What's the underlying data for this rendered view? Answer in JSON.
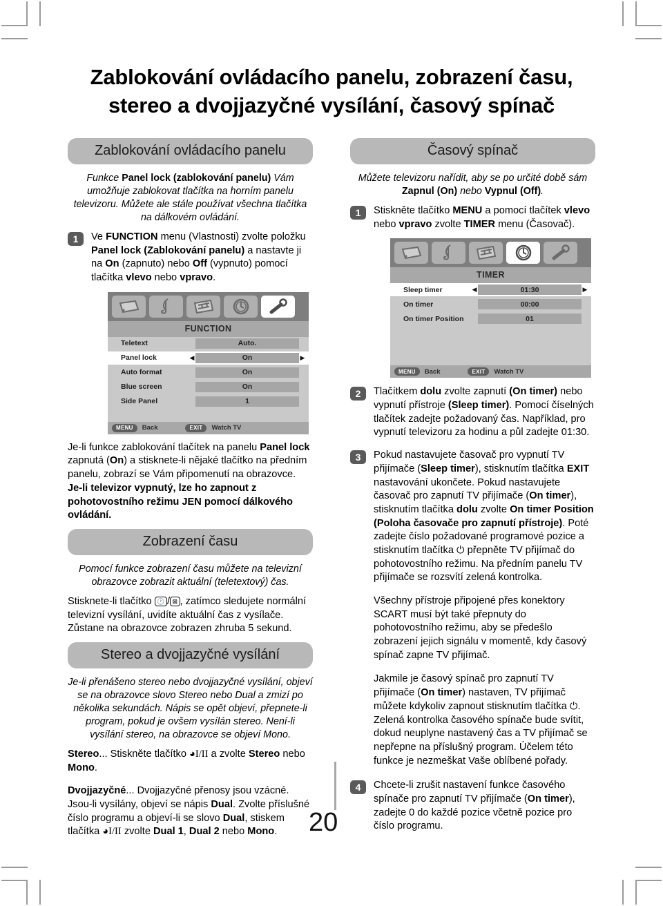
{
  "page": {
    "number": "20",
    "title_line1": "Zablokování ovládacího panelu, zobrazení času,",
    "title_line2": "stereo a dvojjazyčné vysílání, časový spínač"
  },
  "left_column": {
    "section1": {
      "banner": "Zablokování ovládacího panelu",
      "intro": "Funkce Panel lock (zablokování panelu) Vám umožňuje zablokovat tlačítka na horním panelu televizoru. Můžete ale stále používat všechna tlačítka na dálkovém ovládání.",
      "step1_number": "1",
      "step1_text": "Ve FUNCTION menu (Vlastnosti) zvolte položku Panel lock (Zablokování panelu) a nastavte ji na On (zapnuto) nebo Off (vypnuto) pomocí tlačítka vlevo nebo vpravo.",
      "after_text": "Je-li funkce zablokování tlačítek na panelu Panel lock zapnutá (On) a stisknete-li nějaké tlačítko na předním panelu, zobrazí se Vám připomenutí na obrazovce. Je-li televizor vypnutý, lze ho zapnout z pohotovostního režimu JEN pomocí dálkového ovládání."
    },
    "function_menu": {
      "title": "FUNCTION",
      "icons": [
        "picture-icon",
        "sound-icon",
        "feature-icon",
        "timer-icon",
        "setup-icon"
      ],
      "selected_icon_index": 4,
      "rows": [
        {
          "label": "Teletext",
          "value": "Auto.",
          "active": false
        },
        {
          "label": "Panel lock",
          "value": "On",
          "active": true
        },
        {
          "label": "Auto format",
          "value": "On",
          "active": false
        },
        {
          "label": "Blue screen",
          "value": "On",
          "active": false
        },
        {
          "label": "Side Panel",
          "value": "1",
          "active": false
        }
      ],
      "footer_menu_key": "MENU",
      "footer_menu_label": "Back",
      "footer_exit_key": "EXIT",
      "footer_exit_label": "Watch TV"
    },
    "section2": {
      "banner": "Zobrazení času",
      "intro": "Pomocí funkce zobrazení času můžete na televizní obrazovce zobrazit aktuální (teletextový) čas.",
      "body_a": "Stisknete-li tlačítko",
      "body_b": ", zatímco sledujete normální televizní vysílání, uvidíte aktuální čas z vysílače. Zůstane na obrazovce zobrazen zhruba 5 sekund."
    },
    "section3": {
      "banner": "Stereo a dvojjazyčné vysílání",
      "intro": "Je-li přenášeno stereo nebo dvojjazyčné vysílání, objeví se  na obrazovce slovo Stereo nebo Dual a zmizí po několika sekundách. Nápis se opět objeví, přepnete-li program, pokud je ovšem vysílán stereo. Není-li vysílání stereo, na obrazovce se objeví Mono.",
      "stereo_label": "Stereo",
      "stereo_a": "... Stiskněte tlačítko",
      "stereo_b": "a zvolte Stereo nebo Mono.",
      "dual_label": "Dvojjazyčné",
      "dual_a": "... Dvojjazyčné přenosy jsou vzácné. Jsou-li vysílány, objeví se nápis Dual. Zvolte příslušné číslo programu a objeví-li se slovo Dual, stiskem tlačítka",
      "dual_b": "zvolte Dual 1, Dual 2 nebo Mono."
    }
  },
  "right_column": {
    "banner": "Časový spínač",
    "intro_a": "Můžete televizoru nařídit, aby se po určité době sám ",
    "intro_b": "Zapnul (On)",
    "intro_c": " nebo ",
    "intro_d": "Vypnul (Off)",
    "intro_e": ".",
    "step1_number": "1",
    "step1_text": "Stiskněte tlačítko MENU a pomocí tlačítek vlevo nebo vpravo zvolte TIMER menu (Časovač).",
    "timer_menu": {
      "title": "TIMER",
      "icons": [
        "picture-icon",
        "sound-icon",
        "feature-icon",
        "timer-icon",
        "setup-icon"
      ],
      "selected_icon_index": 3,
      "rows": [
        {
          "label": "Sleep timer",
          "value": "01:30",
          "active": true
        },
        {
          "label": "On timer",
          "value": "00:00",
          "active": false
        },
        {
          "label": "On timer Position",
          "value": "01",
          "active": false
        }
      ],
      "footer_menu_key": "MENU",
      "footer_menu_label": "Back",
      "footer_exit_key": "EXIT",
      "footer_exit_label": "Watch TV"
    },
    "step2_number": "2",
    "step2_text": "Tlačítkem dolu zvolte zapnutí (On timer) nebo vypnutí přístroje (Sleep timer). Pomocí číselných tlačítek zadejte požadovaný čas. Například, pro vypnutí televizoru za hodinu a půl zadejte 01:30.",
    "step3_number": "3",
    "step3_text_a": "Pokud nastavujete časovač pro vypnutí TV přijímače (Sleep timer), stisknutím tlačítka EXIT nastavování ukončete. Pokud nastavujete časovač pro zapnutí TV přijímače (On timer), stisknutím tlačítka dolu zvolte On timer Position (Poloha časovače pro zapnutí přístroje). Poté zadejte číslo požadované programové pozice a stisknutím tlačítka",
    "step3_text_b": "přepněte TV přijímač do pohotovostního režimu. Na předním panelu TV přijímače se rozsvítí zelená kontrolka.",
    "para_scart": "Všechny přístroje připojené přes konektory SCART musí být také přepnuty do pohotovostního režimu, aby se předešlo zobrazení jejich signálu v momentě, kdy časový spínač zapne TV přijímač.",
    "para_on_a": "Jakmile je časový spínač pro zapnutí TV přijímače (On timer) nastaven, TV přijímač můžete kdykoliv zapnout stisknutím tlačítka",
    "para_on_b": ". Zelená kontrolka časového spínače bude svítit, dokud neuplyne nastavený čas a TV přijímač se nepřepne na příslušný program. Účelem této funkce je nezmeškat Vaše oblíbené pořady.",
    "step4_number": "4",
    "step4_text": "Chcete-li zrušit nastavení funkce časového spínače pro zapnutí TV přijímače (On timer), zadejte 0 do každé pozice včetně pozice pro číslo programu."
  },
  "colors": {
    "banner_bg": "#b8b8b8",
    "step_badge_bg": "#5a5a5a",
    "osd_header_bg": "#7e7e7e",
    "osd_body_bg": "#c9c9c9",
    "osd_value_bg": "#a6a6a6"
  }
}
